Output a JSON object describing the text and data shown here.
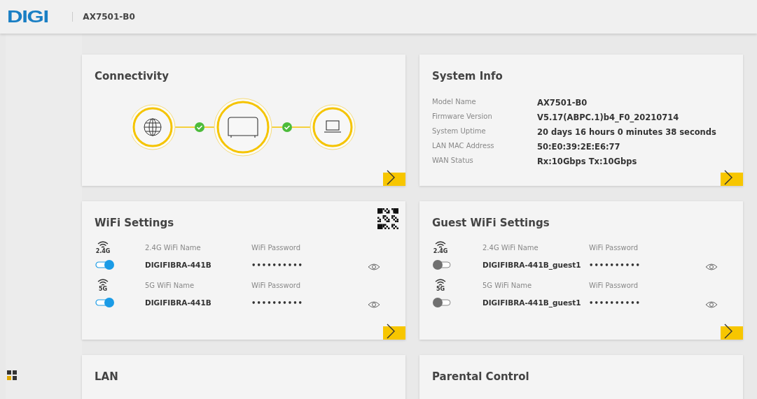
{
  "header": {
    "logo": "DIGI",
    "model": "AX7501-B0"
  },
  "cards": [
    {
      "kind": "connectivity",
      "title": "Connectivity"
    },
    {
      "kind": "info",
      "title": "System Info",
      "rows": [
        {
          "label": "Model Name",
          "value": "AX7501-B0"
        },
        {
          "label": "Firmware Version",
          "value": "V5.17(ABPC.1)b4_F0_20210714"
        },
        {
          "label": "System Uptime",
          "value": "20 days 16 hours 0 minutes 38 seconds"
        },
        {
          "label": "LAN MAC Address",
          "value": "50:E0:39:2E:E6:77"
        },
        {
          "label": "WAN Status",
          "value": "Rx:10Gbps Tx:10Gbps"
        }
      ]
    },
    {
      "kind": "wifi",
      "title": "WiFi Settings",
      "qr": true,
      "bands": [
        {
          "band": "2.4G",
          "name_label": "2.4G WiFi Name",
          "name": "DIGIFIBRA-441B",
          "password_label": "WiFi Password",
          "password": "••••••••••",
          "on": true
        },
        {
          "band": "5G",
          "name_label": "5G WiFi Name",
          "name": "DIGIFIBRA-441B",
          "password_label": "WiFi Password",
          "password": "••••••••••",
          "on": true
        }
      ]
    },
    {
      "kind": "wifi",
      "title": "Guest WiFi Settings",
      "qr": false,
      "bands": [
        {
          "band": "2.4G",
          "name_label": "2.4G WiFi Name",
          "name": "DIGIFIBRA-441B_guest1",
          "password_label": "WiFi Password",
          "password": "••••••••••",
          "on": false
        },
        {
          "band": "5G",
          "name_label": "5G WiFi Name",
          "name": "DIGIFIBRA-441B_guest1",
          "password_label": "WiFi Password",
          "password": "••••••••••",
          "on": false
        }
      ]
    },
    {
      "kind": "plain",
      "title": "LAN"
    },
    {
      "kind": "plain",
      "title": "Parental Control"
    }
  ]
}
